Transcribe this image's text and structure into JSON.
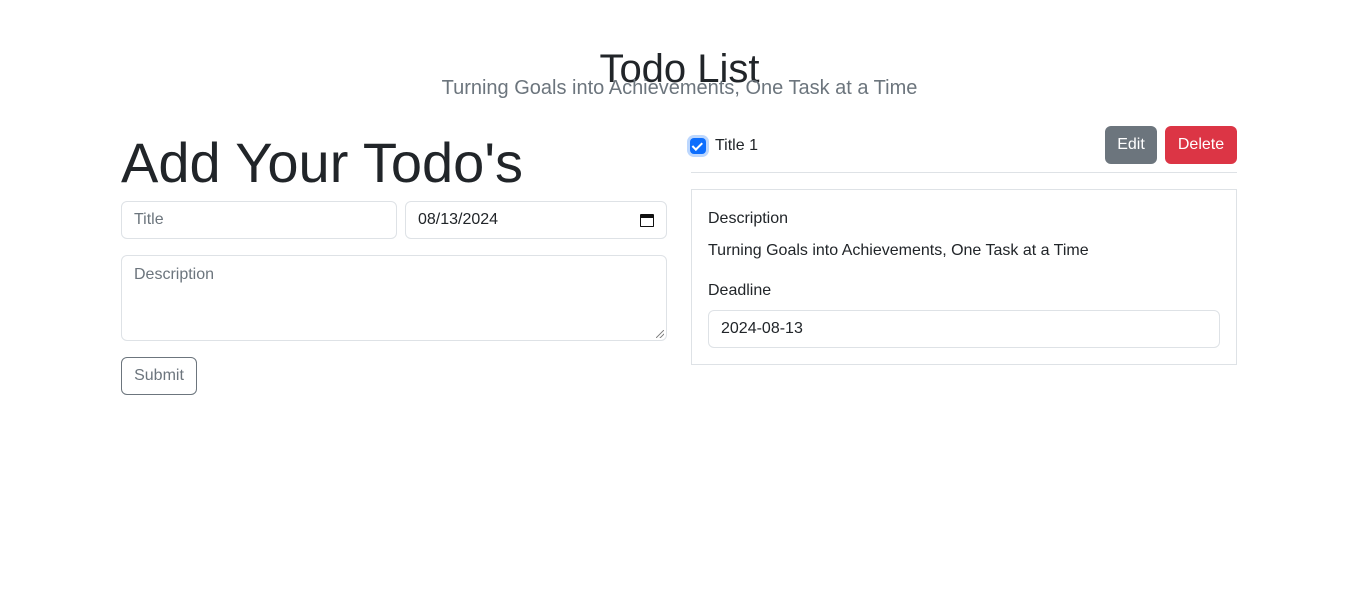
{
  "header": {
    "title": "Todo List",
    "subtitle": "Turning Goals into Achievements, One Task at a Time"
  },
  "form": {
    "heading": "Add Your Todo's",
    "title_placeholder": "Title",
    "date_value": "08/13/2024",
    "description_placeholder": "Description",
    "submit_label": "Submit"
  },
  "todos": [
    {
      "title": "Title 1",
      "checked": true,
      "edit_label": "Edit",
      "delete_label": "Delete",
      "description_label": "Description",
      "description": "Turning Goals into Achievements, One Task at a Time",
      "deadline_label": "Deadline",
      "deadline": "2024-08-13"
    }
  ],
  "colors": {
    "primary": "#0d6efd",
    "secondary": "#6c757d",
    "danger": "#dc3545",
    "border": "#dee2e6"
  },
  "icons": {
    "date_picker": "calendar-icon",
    "checkbox": "check-icon"
  }
}
